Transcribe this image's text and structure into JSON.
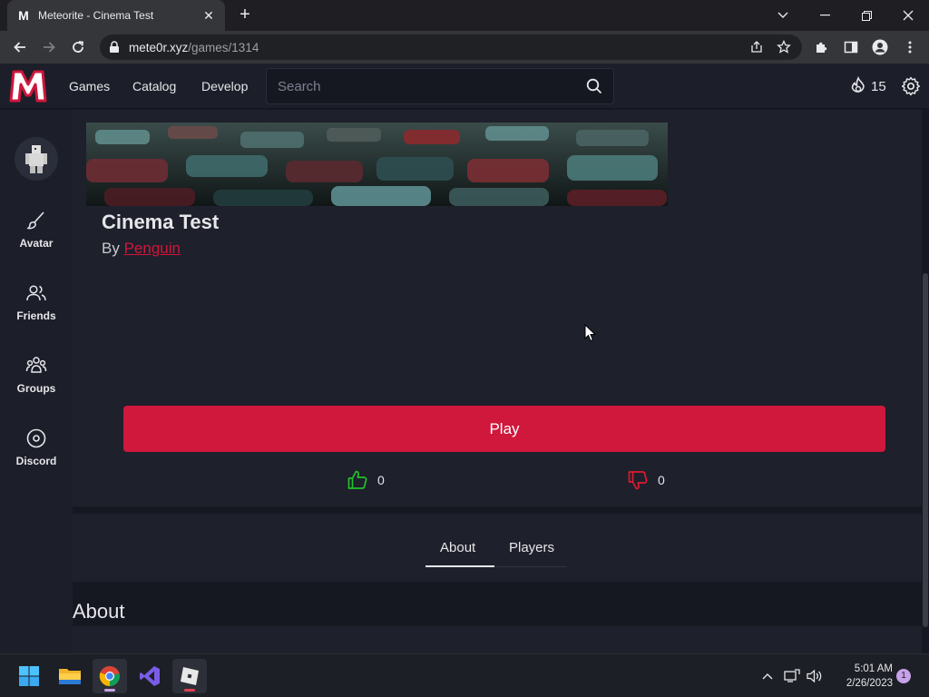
{
  "browser": {
    "tab_title": "Meteorite - Cinema Test",
    "tab_favicon": "M",
    "url_host": "mete0r.xyz",
    "url_path": "/games/1314"
  },
  "header": {
    "logo_letter": "M",
    "nav": [
      "Games",
      "Catalog",
      "Develop"
    ],
    "search_placeholder": "Search",
    "currency_count": "15",
    "accent_color": "#d0173c"
  },
  "sidebar": {
    "items": [
      {
        "label": "Avatar",
        "icon": "brush-icon"
      },
      {
        "label": "Friends",
        "icon": "friends-icon"
      },
      {
        "label": "Groups",
        "icon": "groups-icon"
      },
      {
        "label": "Discord",
        "icon": "discord-icon"
      }
    ]
  },
  "game": {
    "title": "Cinema Test",
    "by_prefix": "By",
    "creator": "Penguin",
    "play_label": "Play",
    "likes": "0",
    "dislikes": "0"
  },
  "tabs": {
    "items": [
      "About",
      "Players"
    ],
    "active": "About"
  },
  "about": {
    "heading": "About"
  },
  "taskbar": {
    "time": "5:01 AM",
    "date": "2/26/2023",
    "notification_count": "1"
  }
}
